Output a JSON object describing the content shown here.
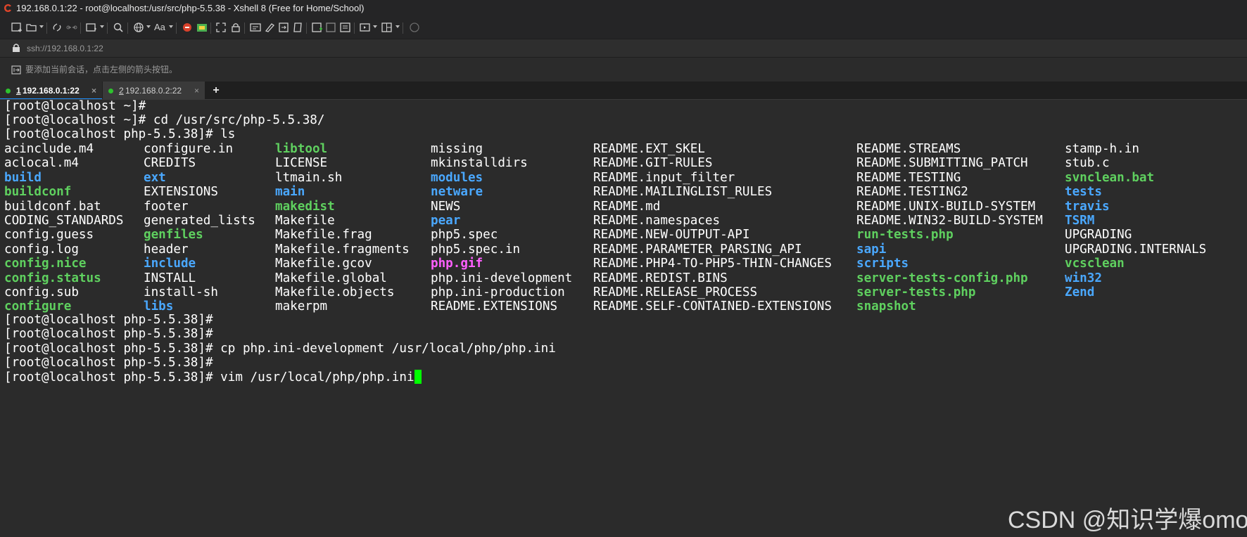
{
  "window": {
    "title": "192.168.0.1:22 - root@localhost:/usr/src/php-5.5.38 - Xshell 8 (Free for Home/School)"
  },
  "toolbar": {
    "icons": [
      "new-session-icon",
      "open-folder-icon",
      "reconnect-icon",
      "disconnect-icon",
      "new-tab-icon",
      "find-icon",
      "globe-icon",
      "font-icon",
      "xshell-icon",
      "xftp-icon",
      "fullscreen-icon",
      "lock-icon",
      "compose-icon",
      "highlight-icon",
      "send-key-icon",
      "script-icon",
      "new-pane-icon",
      "layout-icon",
      "tile-icon",
      "tunnel-icon",
      "split-icon",
      "help-icon"
    ]
  },
  "address": {
    "url": "ssh://192.168.0.1:22"
  },
  "hint": {
    "text": "要添加当前会话，点击左侧的箭头按钮。"
  },
  "tabs": [
    {
      "num": "1",
      "host": "192.168.0.1:22",
      "active": true,
      "close": "×"
    },
    {
      "num": "2",
      "host": "192.168.0.2:22",
      "active": false,
      "close": "×"
    }
  ],
  "new_tab_label": "+",
  "terminal": {
    "lines_before": [
      "[root@localhost ~]#",
      "[root@localhost ~]# cd /usr/src/php-5.5.38/",
      "[root@localhost php-5.5.38]# ls"
    ],
    "ls_columns": [
      [
        {
          "name": "acinclude.m4",
          "type": "file"
        },
        {
          "name": "aclocal.m4",
          "type": "file"
        },
        {
          "name": "build",
          "type": "dir"
        },
        {
          "name": "buildconf",
          "type": "exe"
        },
        {
          "name": "buildconf.bat",
          "type": "file"
        },
        {
          "name": "CODING_STANDARDS",
          "type": "file"
        },
        {
          "name": "config.guess",
          "type": "file"
        },
        {
          "name": "config.log",
          "type": "file"
        },
        {
          "name": "config.nice",
          "type": "exe"
        },
        {
          "name": "config.status",
          "type": "exe"
        },
        {
          "name": "config.sub",
          "type": "file"
        },
        {
          "name": "configure",
          "type": "exe"
        }
      ],
      [
        {
          "name": "configure.in",
          "type": "file"
        },
        {
          "name": "CREDITS",
          "type": "file"
        },
        {
          "name": "ext",
          "type": "dir"
        },
        {
          "name": "EXTENSIONS",
          "type": "file"
        },
        {
          "name": "footer",
          "type": "file"
        },
        {
          "name": "generated_lists",
          "type": "file"
        },
        {
          "name": "genfiles",
          "type": "exe"
        },
        {
          "name": "header",
          "type": "file"
        },
        {
          "name": "include",
          "type": "dir"
        },
        {
          "name": "INSTALL",
          "type": "file"
        },
        {
          "name": "install-sh",
          "type": "file"
        },
        {
          "name": "libs",
          "type": "dir"
        }
      ],
      [
        {
          "name": "libtool",
          "type": "exe"
        },
        {
          "name": "LICENSE",
          "type": "file"
        },
        {
          "name": "ltmain.sh",
          "type": "file"
        },
        {
          "name": "main",
          "type": "dir"
        },
        {
          "name": "makedist",
          "type": "exe"
        },
        {
          "name": "Makefile",
          "type": "file"
        },
        {
          "name": "Makefile.frag",
          "type": "file"
        },
        {
          "name": "Makefile.fragments",
          "type": "file"
        },
        {
          "name": "Makefile.gcov",
          "type": "file"
        },
        {
          "name": "Makefile.global",
          "type": "file"
        },
        {
          "name": "Makefile.objects",
          "type": "file"
        },
        {
          "name": "makerpm",
          "type": "file"
        }
      ],
      [
        {
          "name": "missing",
          "type": "file"
        },
        {
          "name": "mkinstalldirs",
          "type": "file"
        },
        {
          "name": "modules",
          "type": "dir"
        },
        {
          "name": "netware",
          "type": "dir"
        },
        {
          "name": "NEWS",
          "type": "file"
        },
        {
          "name": "pear",
          "type": "dir"
        },
        {
          "name": "php5.spec",
          "type": "file"
        },
        {
          "name": "php5.spec.in",
          "type": "file"
        },
        {
          "name": "php.gif",
          "type": "img"
        },
        {
          "name": "php.ini-development",
          "type": "file"
        },
        {
          "name": "php.ini-production",
          "type": "file"
        },
        {
          "name": "README.EXTENSIONS",
          "type": "file"
        }
      ],
      [
        {
          "name": "README.EXT_SKEL",
          "type": "file"
        },
        {
          "name": "README.GIT-RULES",
          "type": "file"
        },
        {
          "name": "README.input_filter",
          "type": "file"
        },
        {
          "name": "README.MAILINGLIST_RULES",
          "type": "file"
        },
        {
          "name": "README.md",
          "type": "file"
        },
        {
          "name": "README.namespaces",
          "type": "file"
        },
        {
          "name": "README.NEW-OUTPUT-API",
          "type": "file"
        },
        {
          "name": "README.PARAMETER_PARSING_API",
          "type": "file"
        },
        {
          "name": "README.PHP4-TO-PHP5-THIN-CHANGES",
          "type": "file"
        },
        {
          "name": "README.REDIST.BINS",
          "type": "file"
        },
        {
          "name": "README.RELEASE_PROCESS",
          "type": "file"
        },
        {
          "name": "README.SELF-CONTAINED-EXTENSIONS",
          "type": "file"
        }
      ],
      [
        {
          "name": "README.STREAMS",
          "type": "file"
        },
        {
          "name": "README.SUBMITTING_PATCH",
          "type": "file"
        },
        {
          "name": "README.TESTING",
          "type": "file"
        },
        {
          "name": "README.TESTING2",
          "type": "file"
        },
        {
          "name": "README.UNIX-BUILD-SYSTEM",
          "type": "file"
        },
        {
          "name": "README.WIN32-BUILD-SYSTEM",
          "type": "file"
        },
        {
          "name": "run-tests.php",
          "type": "exe"
        },
        {
          "name": "sapi",
          "type": "dir"
        },
        {
          "name": "scripts",
          "type": "dir"
        },
        {
          "name": "server-tests-config.php",
          "type": "exe"
        },
        {
          "name": "server-tests.php",
          "type": "exe"
        },
        {
          "name": "snapshot",
          "type": "exe"
        }
      ],
      [
        {
          "name": "stamp-h.in",
          "type": "file"
        },
        {
          "name": "stub.c",
          "type": "file"
        },
        {
          "name": "svnclean.bat",
          "type": "exe"
        },
        {
          "name": "tests",
          "type": "dir"
        },
        {
          "name": "travis",
          "type": "dir"
        },
        {
          "name": "TSRM",
          "type": "dir"
        },
        {
          "name": "UPGRADING",
          "type": "file"
        },
        {
          "name": "UPGRADING.INTERNALS",
          "type": "file"
        },
        {
          "name": "vcsclean",
          "type": "exe"
        },
        {
          "name": "win32",
          "type": "dir"
        },
        {
          "name": "Zend",
          "type": "dir"
        }
      ]
    ],
    "lines_after": [
      "[root@localhost php-5.5.38]#",
      "[root@localhost php-5.5.38]#",
      "[root@localhost php-5.5.38]# cp php.ini-development /usr/local/php/php.ini",
      "[root@localhost php-5.5.38]#",
      "[root@localhost php-5.5.38]# vim /usr/local/php/php.ini"
    ]
  },
  "watermark": "CSDN @知识学爆omo",
  "colors": {
    "background": "#2b2b2b",
    "text": "#ffffff",
    "dir": "#4aa8ff",
    "exe": "#5fd05f",
    "image": "#ff5fff",
    "cursor": "#00ff00",
    "tab_dot": "#2ec32e"
  }
}
